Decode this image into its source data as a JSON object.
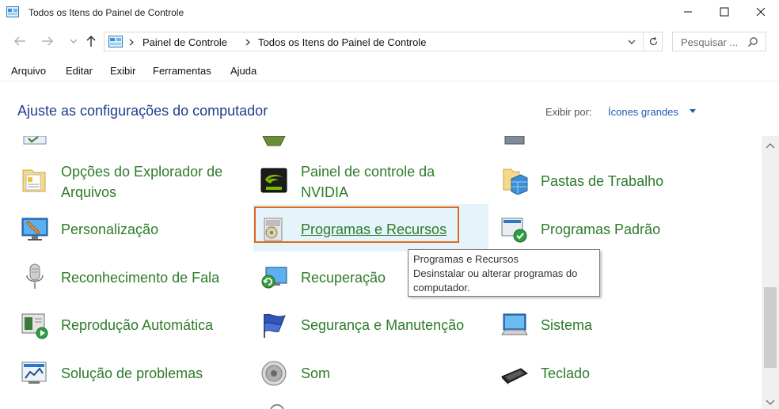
{
  "window": {
    "title": "Todos os Itens do Painel de Controle"
  },
  "address": {
    "crumbs": [
      "Painel de Controle",
      "Todos os Itens do Painel de Controle"
    ]
  },
  "search": {
    "placeholder": "Pesquisar ..."
  },
  "menu": [
    "Arquivo",
    "Editar",
    "Exibir",
    "Ferramentas",
    "Ajuda"
  ],
  "header": {
    "title": "Ajuste as configurações do computador",
    "view_by_label": "Exibir por:",
    "view_by_value": "Ícones grandes"
  },
  "items": {
    "opcoes_explorador": {
      "line1": "Opções do Explorador de",
      "line2": "Arquivos"
    },
    "nvidia": {
      "line1": "Painel de controle da",
      "line2": "NVIDIA"
    },
    "pastas_trabalho": "Pastas de Trabalho",
    "personalizacao": "Personalização",
    "programas_recursos": "Programas e Recursos",
    "programas_padrao": "Programas Padrão",
    "reconhecimento_fala": "Reconhecimento de Fala",
    "recuperacao": "Recuperação",
    "reproducao_automatica": "Reprodução Automática",
    "seguranca_manutencao": "Segurança e Manutenção",
    "sistema": "Sistema",
    "solucao_problemas": "Solução de problemas",
    "som": "Som",
    "teclado": "Teclado"
  },
  "tooltip": {
    "title": "Programas e Recursos",
    "line1": "Desinstalar ou alterar programas do",
    "line2": "computador."
  },
  "colors": {
    "link_green": "#2d7b2a",
    "heading_blue": "#1e3d8c",
    "highlight_orange": "#e06a1c",
    "hover_blue": "#e5f3fb"
  }
}
